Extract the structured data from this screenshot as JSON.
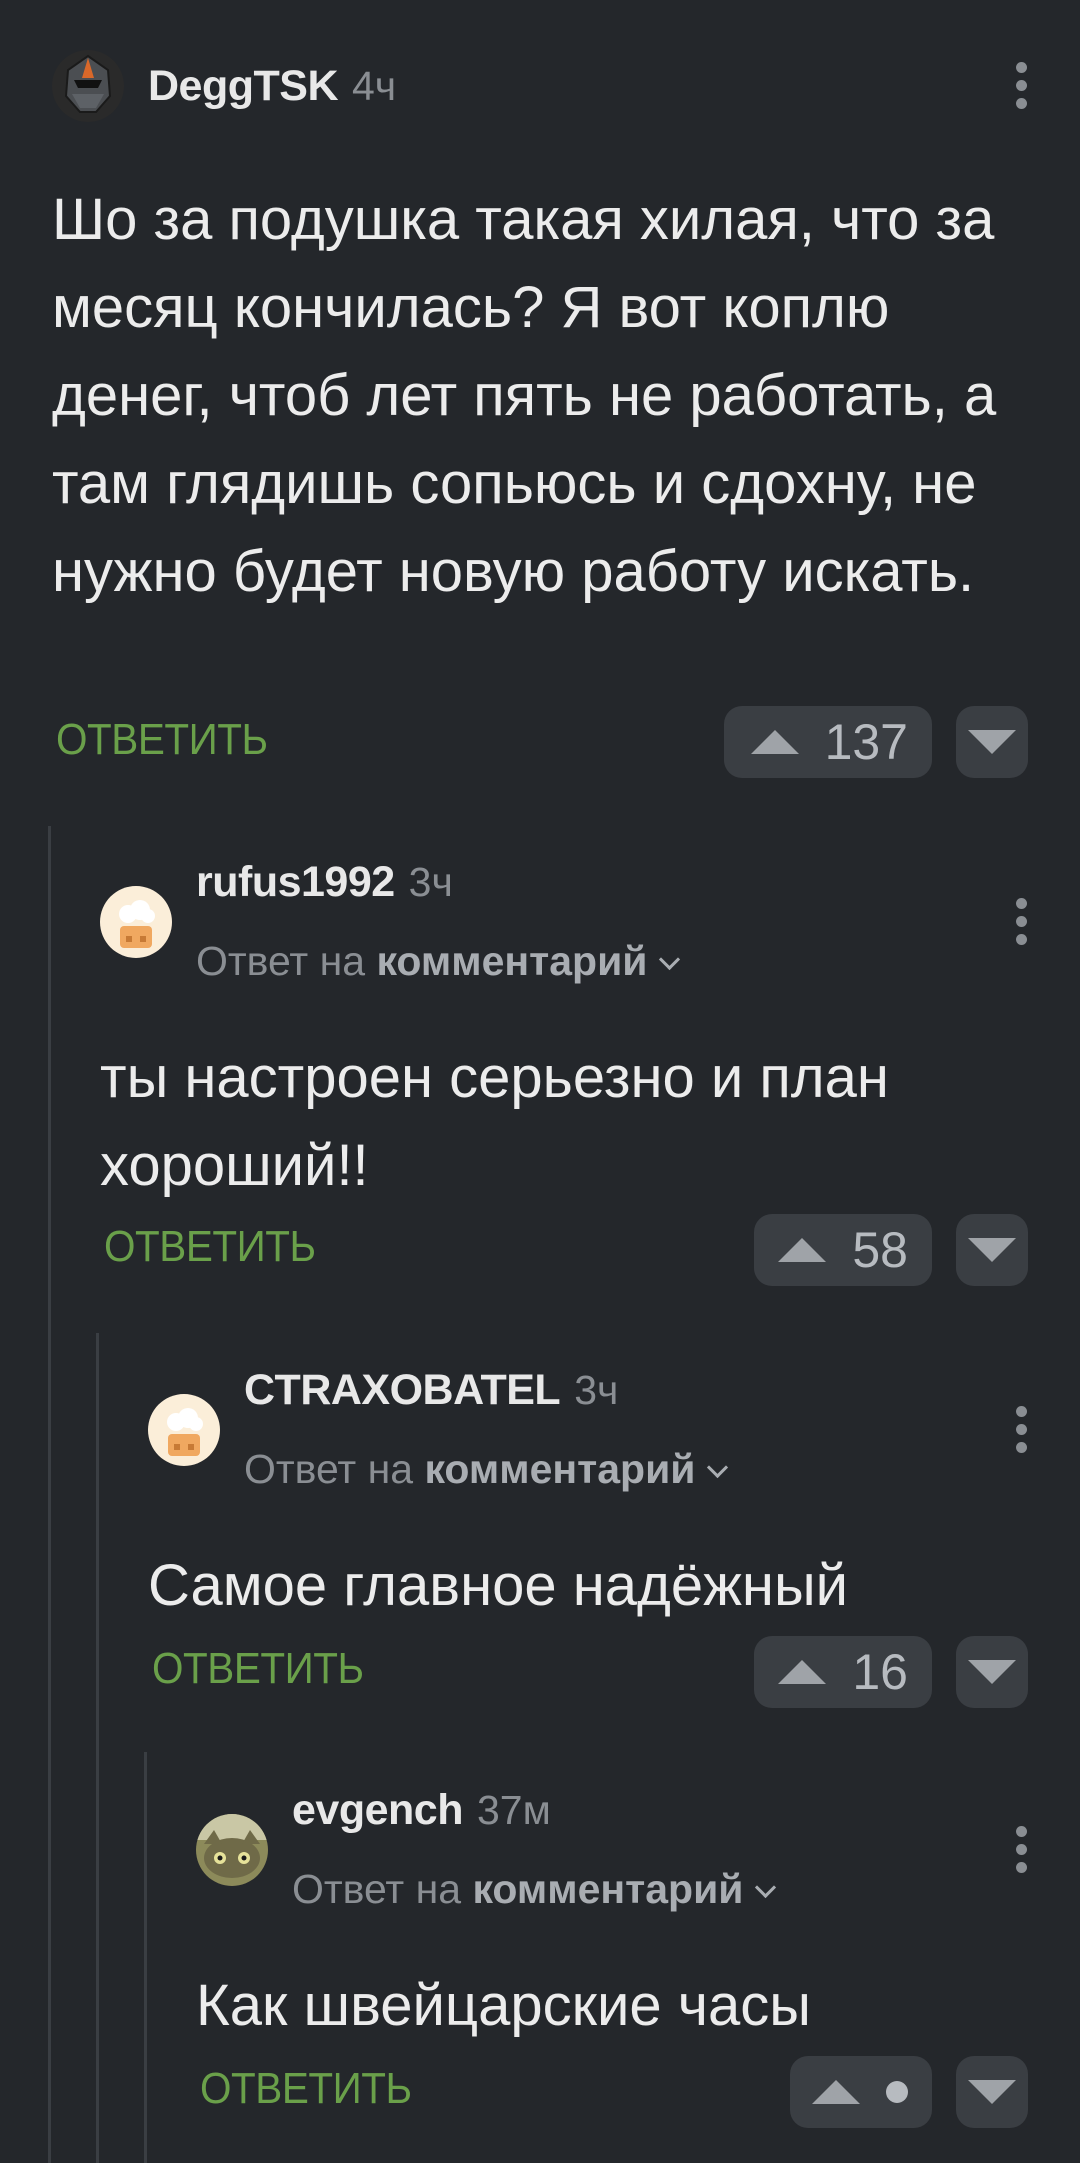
{
  "reply_label": "ОТВЕТИТЬ",
  "reply_to_prefix": "Ответ на",
  "reply_to_target": "комментарий",
  "comments": [
    {
      "user": "DeggTSK",
      "time": "4ч",
      "text": "Шо за подушка такая хилая, что за месяц кончилась? Я вот коплю денег, чтоб лет пять не работать, а там глядишь сопьюсь и сдохну, не нужно будет новую работу искать.",
      "rating": "137",
      "avatar": "knight-helmet-avatar"
    },
    {
      "user": "rufus1992",
      "time": "3ч",
      "text": "ты настроен серьезно и план хороший!!",
      "rating": "58",
      "avatar": "default-avatar"
    },
    {
      "user": "CTRAXOBATEL",
      "time": "3ч",
      "text": "Самое главное надёжный",
      "rating": "16",
      "avatar": "default-avatar"
    },
    {
      "user": "evgench",
      "time": "37м",
      "text": "Как швейцарские часы",
      "rating": "",
      "avatar": "cat-avatar"
    }
  ],
  "colors": {
    "background": "#24272b",
    "reply_accent": "#6aa04a",
    "thread_line": "#3a3e43"
  }
}
